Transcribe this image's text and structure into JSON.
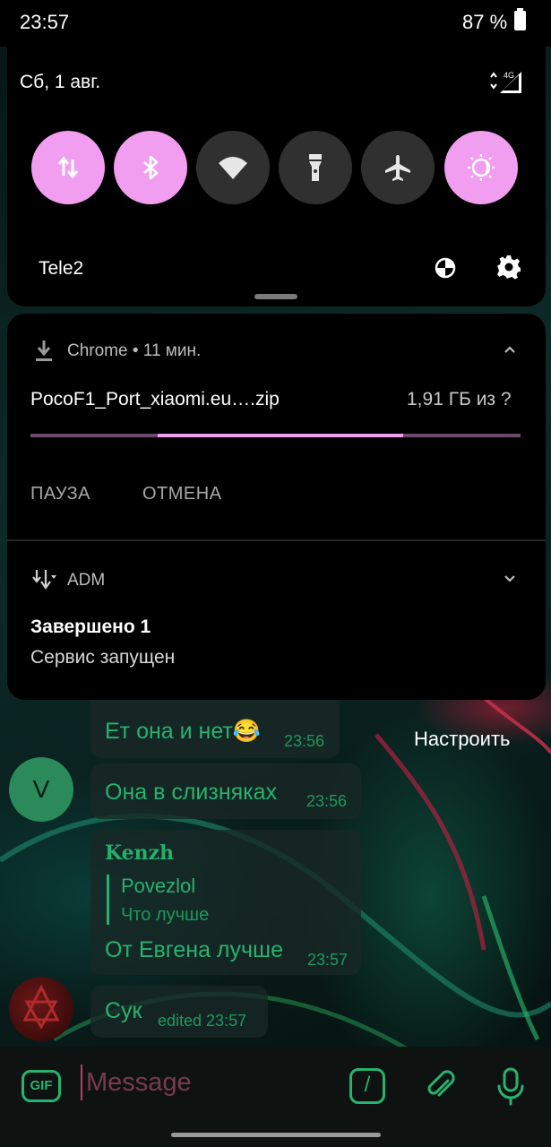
{
  "status_bar": {
    "time": "23:57",
    "battery": "87 %"
  },
  "quick_settings": {
    "date": "Сб, 1 авг.",
    "network_label": "4G",
    "carrier": "Tele2",
    "tiles": [
      {
        "name": "mobile-data",
        "icon": "data-arrows-icon",
        "on": true
      },
      {
        "name": "bluetooth",
        "icon": "bluetooth-icon",
        "on": true
      },
      {
        "name": "wifi",
        "icon": "wifi-icon",
        "on": false
      },
      {
        "name": "flashlight",
        "icon": "flashlight-icon",
        "on": false
      },
      {
        "name": "airplane-mode",
        "icon": "airplane-icon",
        "on": false
      },
      {
        "name": "night-light",
        "icon": "night-light-icon",
        "on": true
      }
    ]
  },
  "notifications": [
    {
      "app": "Chrome • 11 мин.",
      "title": "PocoF1_Port_xiaomi.eu….zip",
      "progress_text": "1,91 ГБ из ?",
      "progress_fraction": 0.76,
      "progress_indeterminate_start": 0.26,
      "actions": [
        "ПАУЗА",
        "ОТМЕНА"
      ]
    },
    {
      "app": "ADM",
      "title": "Завершено 1",
      "text": "Сервис запущен"
    }
  ],
  "customize_label": "Настроить",
  "chat": {
    "messages": [
      {
        "text": "Ет она и нет😂",
        "time": "23:56"
      },
      {
        "text": "Она в слизняках",
        "time": "23:56",
        "avatar": "V"
      },
      {
        "sender": "Kenzh",
        "reply_name": "Povezlol",
        "reply_text": "Что лучше",
        "text": "От Евгена лучше",
        "time": "23:57"
      },
      {
        "text": "Сук",
        "time": "edited 23:57"
      }
    ],
    "input": {
      "gif": "GIF",
      "placeholder": "Message",
      "command": "/"
    }
  },
  "colors": {
    "accent_pink": "#f29ef0",
    "chat_green": "#27b36f"
  }
}
